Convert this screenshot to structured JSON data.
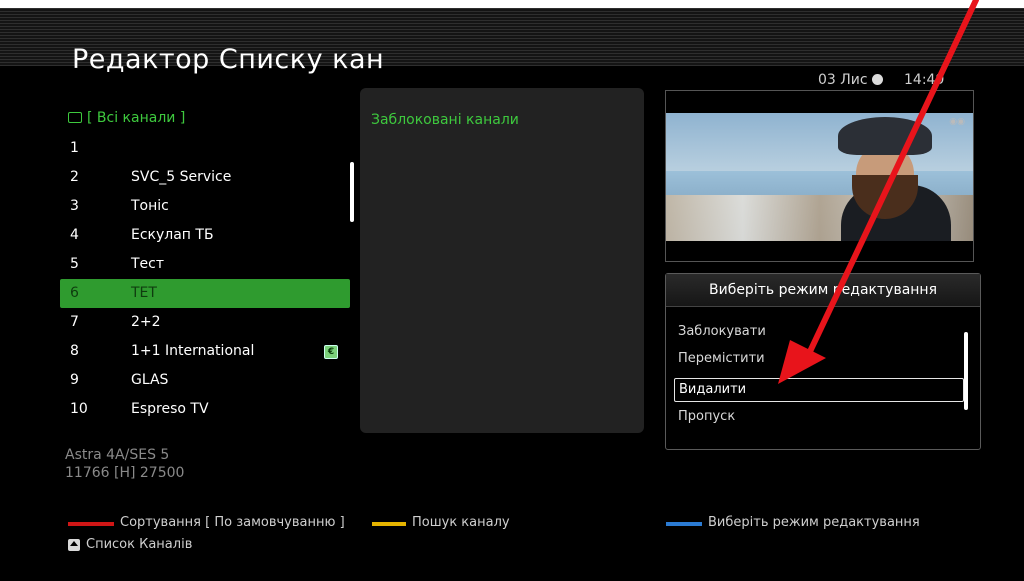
{
  "header": {
    "title": "Редактор Списку кан",
    "date": "03 Лис",
    "time": "14:49"
  },
  "channel_list": {
    "group_label": "[ Всі канали ]",
    "channels": [
      {
        "num": "1",
        "name": ""
      },
      {
        "num": "2",
        "name": "SVC_5 Service"
      },
      {
        "num": "3",
        "name": "Тонiс"
      },
      {
        "num": "4",
        "name": "Ескулап ТБ"
      },
      {
        "num": "5",
        "name": "Тест"
      },
      {
        "num": "6",
        "name": "ТЕТ",
        "selected": true
      },
      {
        "num": "7",
        "name": "2+2"
      },
      {
        "num": "8",
        "name": "1+1 International",
        "badge": "€"
      },
      {
        "num": "9",
        "name": "GLAS"
      },
      {
        "num": "10",
        "name": "Espreso TV"
      }
    ],
    "satellite": "Astra 4A/SES 5",
    "transponder": "11766 [H] 27500"
  },
  "blocked_panel": {
    "title": "Заблоковані канали"
  },
  "mode_menu": {
    "title": "Виберіть режим редактування",
    "options": [
      "Заблокувати",
      "Перемістити",
      "Видалити",
      "Пропуск"
    ],
    "selected_index": 2
  },
  "footer": {
    "red_label": "Сортування [ По замовчуванню ]",
    "yellow_label": "Пошук каналу",
    "blue_label": "Виберіть режим редактування",
    "list_label": "Список Каналів"
  },
  "colors": {
    "accent_green": "#3ec93e",
    "selection_green": "#2f9b2f",
    "annotation_red": "#e8141b",
    "key_red": "#d01616",
    "key_yellow": "#e6b400",
    "key_blue": "#2b7bd3"
  }
}
